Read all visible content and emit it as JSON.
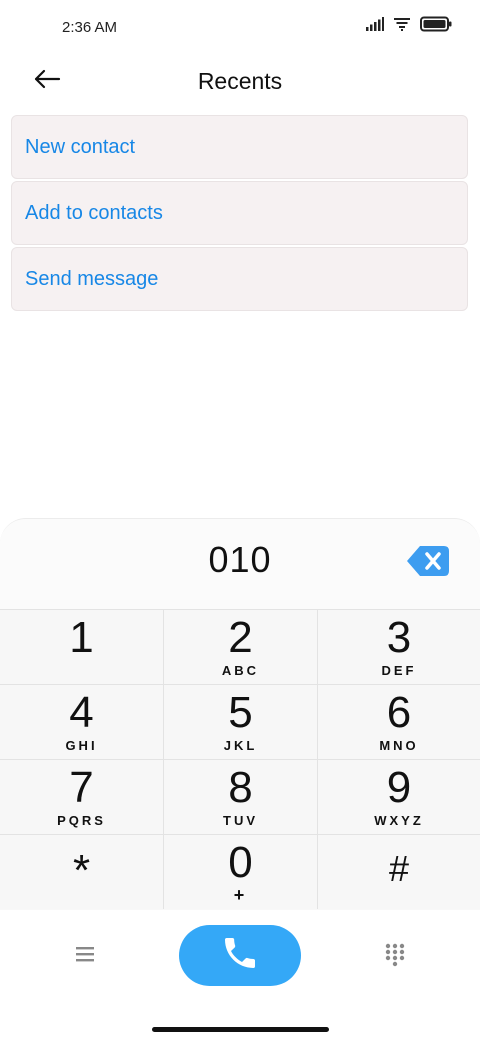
{
  "status_bar": {
    "time": "2:36 AM"
  },
  "header": {
    "title": "Recents"
  },
  "actions": [
    {
      "label": "New contact"
    },
    {
      "label": "Add to contacts"
    },
    {
      "label": "Send message"
    }
  ],
  "dialer": {
    "number": "010",
    "keys": [
      {
        "digit": "1",
        "letters": ""
      },
      {
        "digit": "2",
        "letters": "ABC"
      },
      {
        "digit": "3",
        "letters": "DEF"
      },
      {
        "digit": "4",
        "letters": "GHI"
      },
      {
        "digit": "5",
        "letters": "JKL"
      },
      {
        "digit": "6",
        "letters": "MNO"
      },
      {
        "digit": "7",
        "letters": "PQRS"
      },
      {
        "digit": "8",
        "letters": "TUV"
      },
      {
        "digit": "9",
        "letters": "WXYZ"
      },
      {
        "digit": "*",
        "letters": ""
      },
      {
        "digit": "0",
        "letters": "+"
      },
      {
        "digit": "#",
        "letters": ""
      }
    ]
  },
  "colors": {
    "accent": "#1787e6",
    "call": "#34a8f7",
    "backspace": "#3d9df0"
  },
  "icons": [
    "signal-icon",
    "wifi-icon",
    "battery-icon",
    "back-arrow-icon",
    "backspace-icon",
    "menu-icon",
    "phone-icon",
    "dialpad-grid-icon"
  ]
}
